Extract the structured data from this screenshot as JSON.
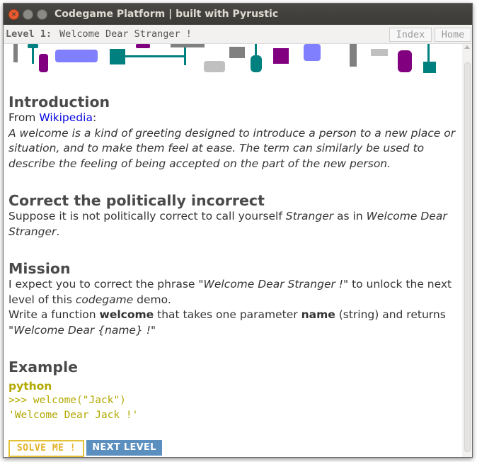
{
  "window": {
    "title": "Codegame Platform | built with Pyrustic"
  },
  "header": {
    "level_label": "Level 1:",
    "level_title": "Welcome Dear Stranger !",
    "index_label": "Index",
    "home_label": "Home"
  },
  "intro": {
    "heading": "Introduction",
    "from_prefix": "From ",
    "source_link": "Wikipedia",
    "from_suffix": ":",
    "quote": "A welcome is a kind of greeting designed to introduce a person to a new place or situation, and to make them feel at ease. The term can similarly be used to describe the feeling of being accepted on the part of the new person."
  },
  "correct": {
    "heading": "Correct the politically incorrect",
    "text_1": "Suppose it is not politically correct to call yourself ",
    "text_2": "Stranger",
    "text_3": " as in ",
    "text_4": "Welcome Dear Stranger",
    "text_5": "."
  },
  "mission": {
    "heading": "Mission",
    "p1_a": "I expect you to correct the phrase \"",
    "p1_b": "Welcome Dear Stranger !",
    "p1_c": "\" to unlock the next level of this ",
    "p1_d": "codegame",
    "p1_e": " demo.",
    "p2_a": "Write a function ",
    "p2_b": "welcome",
    "p2_c": " that takes one parameter ",
    "p2_d": "name",
    "p2_e": " (string) and returns \"",
    "p2_f": "Welcome Dear {name} !",
    "p2_g": "\""
  },
  "example": {
    "heading": "Example",
    "language": "python",
    "code_line_1": ">>> welcome(\"Jack\")",
    "code_line_2": "'Welcome Dear Jack !'"
  },
  "actions": {
    "solve_label": "SOLVE ME !",
    "next_label": "NEXT LEVEL"
  },
  "colors": {
    "teal": "#00807f",
    "purple": "#800080",
    "lavender": "#8080ff",
    "gray": "#808080",
    "light_gray": "#c0c0c0",
    "code": "#b2a800",
    "solve_border": "#e3c23a",
    "next_bg": "#5b8fbf",
    "link": "#0a0adf"
  }
}
